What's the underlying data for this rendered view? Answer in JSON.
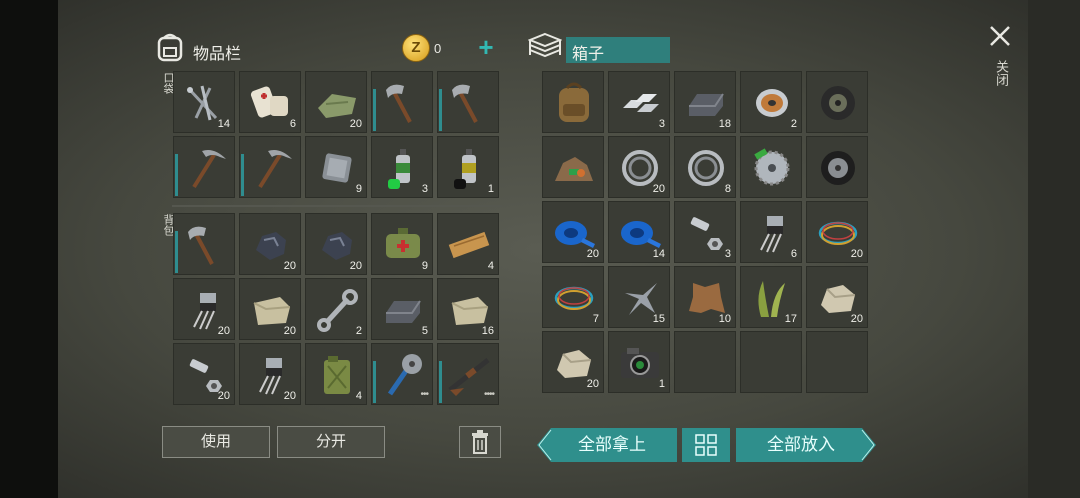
{
  "inventory": {
    "title": "物品栏",
    "coins": "0",
    "add_symbol": "+",
    "pocket_label": "口袋",
    "backpack_label": "背包",
    "pocket_slots": [
      {
        "icon": "nails-icon",
        "count": "14"
      },
      {
        "icon": "bandage-icon",
        "count": "6"
      },
      {
        "icon": "cloth-icon",
        "count": "20"
      },
      {
        "icon": "hatchet-icon",
        "count": ""
      },
      {
        "icon": "hatchet-icon",
        "count": ""
      },
      {
        "icon": "pickaxe-icon",
        "count": ""
      },
      {
        "icon": "pickaxe-icon",
        "count": ""
      },
      {
        "icon": "tin-sheet-icon",
        "count": "9"
      },
      {
        "icon": "spray-paint-green-icon",
        "count": "3"
      },
      {
        "icon": "spray-paint-black-icon",
        "count": "1"
      }
    ],
    "backpack_slots": [
      {
        "icon": "hatchet-icon",
        "count": ""
      },
      {
        "icon": "coal-icon",
        "count": "20"
      },
      {
        "icon": "coal-icon",
        "count": "20"
      },
      {
        "icon": "first-aid-kit-icon",
        "count": "9"
      },
      {
        "icon": "wood-plank-icon",
        "count": "4"
      },
      {
        "icon": "transistor-icon",
        "count": "20"
      },
      {
        "icon": "stone-block-icon",
        "count": "20"
      },
      {
        "icon": "wrench-icon",
        "count": "2"
      },
      {
        "icon": "iron-ingot-icon",
        "count": "5"
      },
      {
        "icon": "stone-block-icon",
        "count": "16"
      },
      {
        "icon": "bolt-nut-icon",
        "count": "20"
      },
      {
        "icon": "transistor-icon",
        "count": "20"
      },
      {
        "icon": "jerrycan-icon",
        "count": "4"
      },
      {
        "icon": "saw-club-icon",
        "count": "•••"
      },
      {
        "icon": "shotgun-icon",
        "count": "••••"
      }
    ],
    "use_label": "使用",
    "split_label": "分开"
  },
  "box": {
    "title": "箱子",
    "slots": [
      {
        "icon": "backpack-icon",
        "count": ""
      },
      {
        "icon": "aluminum-bars-icon",
        "count": "3"
      },
      {
        "icon": "iron-ingot-icon",
        "count": "18"
      },
      {
        "icon": "wire-spool-icon",
        "count": "2"
      },
      {
        "icon": "tire-icon",
        "count": ""
      },
      {
        "icon": "scrap-pile-icon",
        "count": ""
      },
      {
        "icon": "bearing-icon",
        "count": "20"
      },
      {
        "icon": "bearing-icon",
        "count": "8"
      },
      {
        "icon": "saw-blade-icon",
        "count": ""
      },
      {
        "icon": "wheel-icon",
        "count": ""
      },
      {
        "icon": "blue-tape-icon",
        "count": "20"
      },
      {
        "icon": "blue-tape-icon",
        "count": "14"
      },
      {
        "icon": "bolt-nut-icon",
        "count": "3"
      },
      {
        "icon": "transistor-icon",
        "count": "6"
      },
      {
        "icon": "wires-icon",
        "count": "20"
      },
      {
        "icon": "wires-icon",
        "count": "7"
      },
      {
        "icon": "metal-scrap-icon",
        "count": "15"
      },
      {
        "icon": "leather-icon",
        "count": "10"
      },
      {
        "icon": "plant-fiber-icon",
        "count": "17"
      },
      {
        "icon": "stone-icon",
        "count": "20"
      },
      {
        "icon": "stone-icon",
        "count": "20"
      },
      {
        "icon": "camera-icon",
        "count": "1"
      },
      {
        "icon": "",
        "count": ""
      },
      {
        "icon": "",
        "count": ""
      },
      {
        "icon": "",
        "count": ""
      }
    ],
    "take_all_label": "全部拿上",
    "put_all_label": "全部放入"
  },
  "close_label": "关闭",
  "colors": {
    "accent": "#2f8f8c",
    "durability": "#2f8d8f"
  }
}
